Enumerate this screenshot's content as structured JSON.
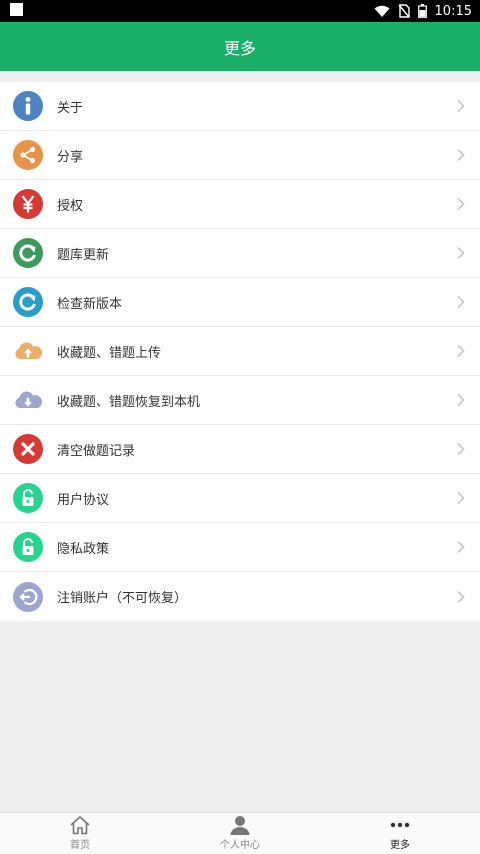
{
  "status": {
    "time": "10:15"
  },
  "header": {
    "title": "更多"
  },
  "menu": [
    {
      "label": "关于",
      "icon": "info-icon"
    },
    {
      "label": "分享",
      "icon": "share-icon"
    },
    {
      "label": "授权",
      "icon": "yen-icon"
    },
    {
      "label": "题库更新",
      "icon": "refresh-green-icon"
    },
    {
      "label": "检查新版本",
      "icon": "refresh-blue-icon"
    },
    {
      "label": "收藏题、错题上传",
      "icon": "cloud-upload-icon"
    },
    {
      "label": "收藏题、错题恢复到本机",
      "icon": "cloud-download-icon"
    },
    {
      "label": "清空做题记录",
      "icon": "clear-icon"
    },
    {
      "label": "用户协议",
      "icon": "lock-icon"
    },
    {
      "label": "隐私政策",
      "icon": "lock-icon"
    },
    {
      "label": "注销账户（不可恢复）",
      "icon": "logout-icon"
    }
  ],
  "tabs": [
    {
      "label": "首页",
      "icon": "home-icon"
    },
    {
      "label": "个人中心",
      "icon": "person-icon"
    },
    {
      "label": "更多",
      "icon": "more-icon"
    }
  ],
  "colors": {
    "accent": "#1ab06a"
  }
}
